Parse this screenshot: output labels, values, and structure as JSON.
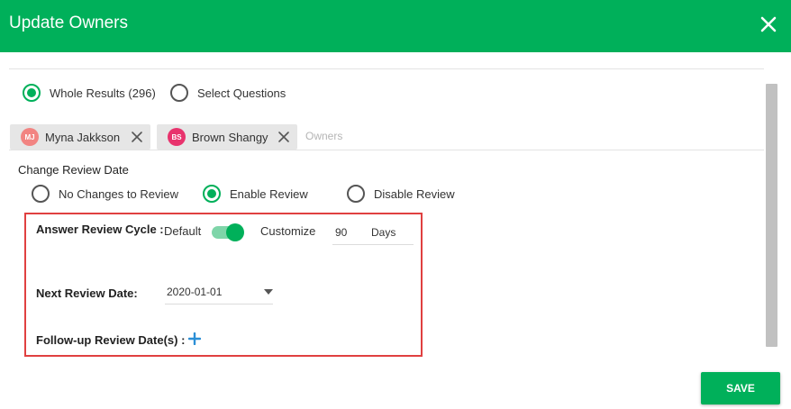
{
  "dialog": {
    "title": "Update Owners",
    "close_icon": "close-icon"
  },
  "scope": {
    "options": [
      {
        "label": "Whole Results (296)",
        "selected": true
      },
      {
        "label": "Select Questions",
        "selected": false
      }
    ]
  },
  "owners": {
    "chips": [
      {
        "initials": "MJ",
        "name": "Myna Jakkson",
        "avatar_color": "#f28482"
      },
      {
        "initials": "BS",
        "name": "Brown Shangy",
        "avatar_color": "#e8336d"
      }
    ],
    "placeholder": "Owners"
  },
  "review": {
    "section_title": "Change Review Date",
    "options": [
      {
        "label": "No Changes to Review",
        "selected": false
      },
      {
        "label": "Enable Review",
        "selected": true
      },
      {
        "label": "Disable Review",
        "selected": false
      }
    ],
    "cycle_label": "Answer Review Cycle :",
    "default_label": "Default",
    "toggle_on": true,
    "customize_label": "Customize",
    "days_value": "90",
    "days_unit": "Days",
    "next_date_label": "Next Review Date:",
    "next_date_value": "2020-01-01",
    "followup_label": "Follow-up Review Date(s) :"
  },
  "footer": {
    "save_label": "SAVE"
  },
  "colors": {
    "brand_green": "#00b05a",
    "highlight_red": "#e04040"
  }
}
